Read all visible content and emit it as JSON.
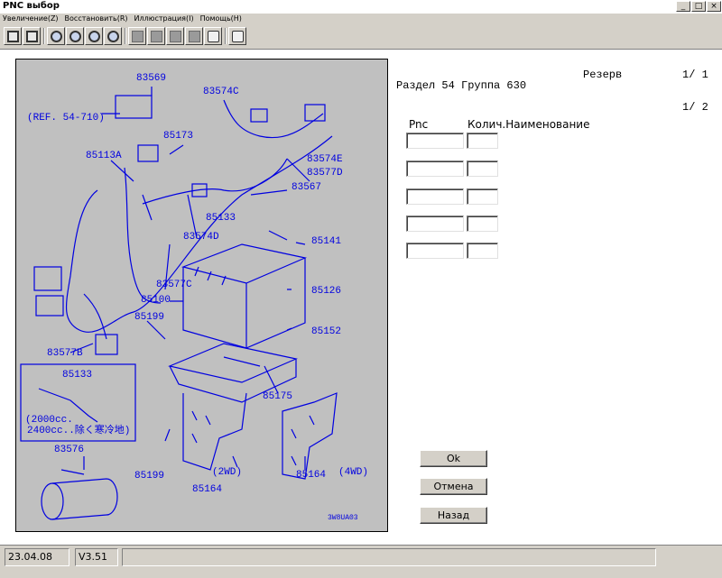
{
  "window": {
    "title": "PNC выбор",
    "min": "_",
    "max": "□",
    "close": "×"
  },
  "menu": [
    "Увеличение(Z)",
    "Восстановить(R)",
    "Иллюстрация(I)",
    "Помощь(H)"
  ],
  "diagram": {
    "callouts": [
      "83569",
      "83574C",
      "(REF. 54-710)",
      "85173",
      "85113A",
      "83574E",
      "83577D",
      "83567",
      "85133",
      "83574D",
      "85141",
      "83577C",
      "85126",
      "85100",
      "85199",
      "85152",
      "83577B",
      "85133",
      "(2000cc.",
      "2400cc..除く寒冷地)",
      "85175",
      "85199",
      "(2WD)",
      "85164",
      "(4WD)",
      "85164",
      "83576",
      "3W8UA03"
    ]
  },
  "info": {
    "reserve_label": "Резерв",
    "page1": "1/ 1",
    "section_title": "Раздел 54 Группа 630",
    "page2": "1/ 2",
    "col_pnc": "Pnc",
    "col_qty_name": "Колич.Наименование"
  },
  "rows": [
    {
      "pnc": "",
      "qty": ""
    },
    {
      "pnc": "",
      "qty": ""
    },
    {
      "pnc": "",
      "qty": ""
    },
    {
      "pnc": "",
      "qty": ""
    },
    {
      "pnc": "",
      "qty": ""
    }
  ],
  "buttons": {
    "ok": "Ok",
    "cancel": "Отмена",
    "back": "Назад"
  },
  "status": {
    "date": "23.04.08",
    "version": "V3.51",
    "message": ""
  },
  "colors": {
    "diagram_ink": "#0000e0",
    "diagram_bg": "#c0c0c0",
    "chrome": "#d4d0c8"
  }
}
